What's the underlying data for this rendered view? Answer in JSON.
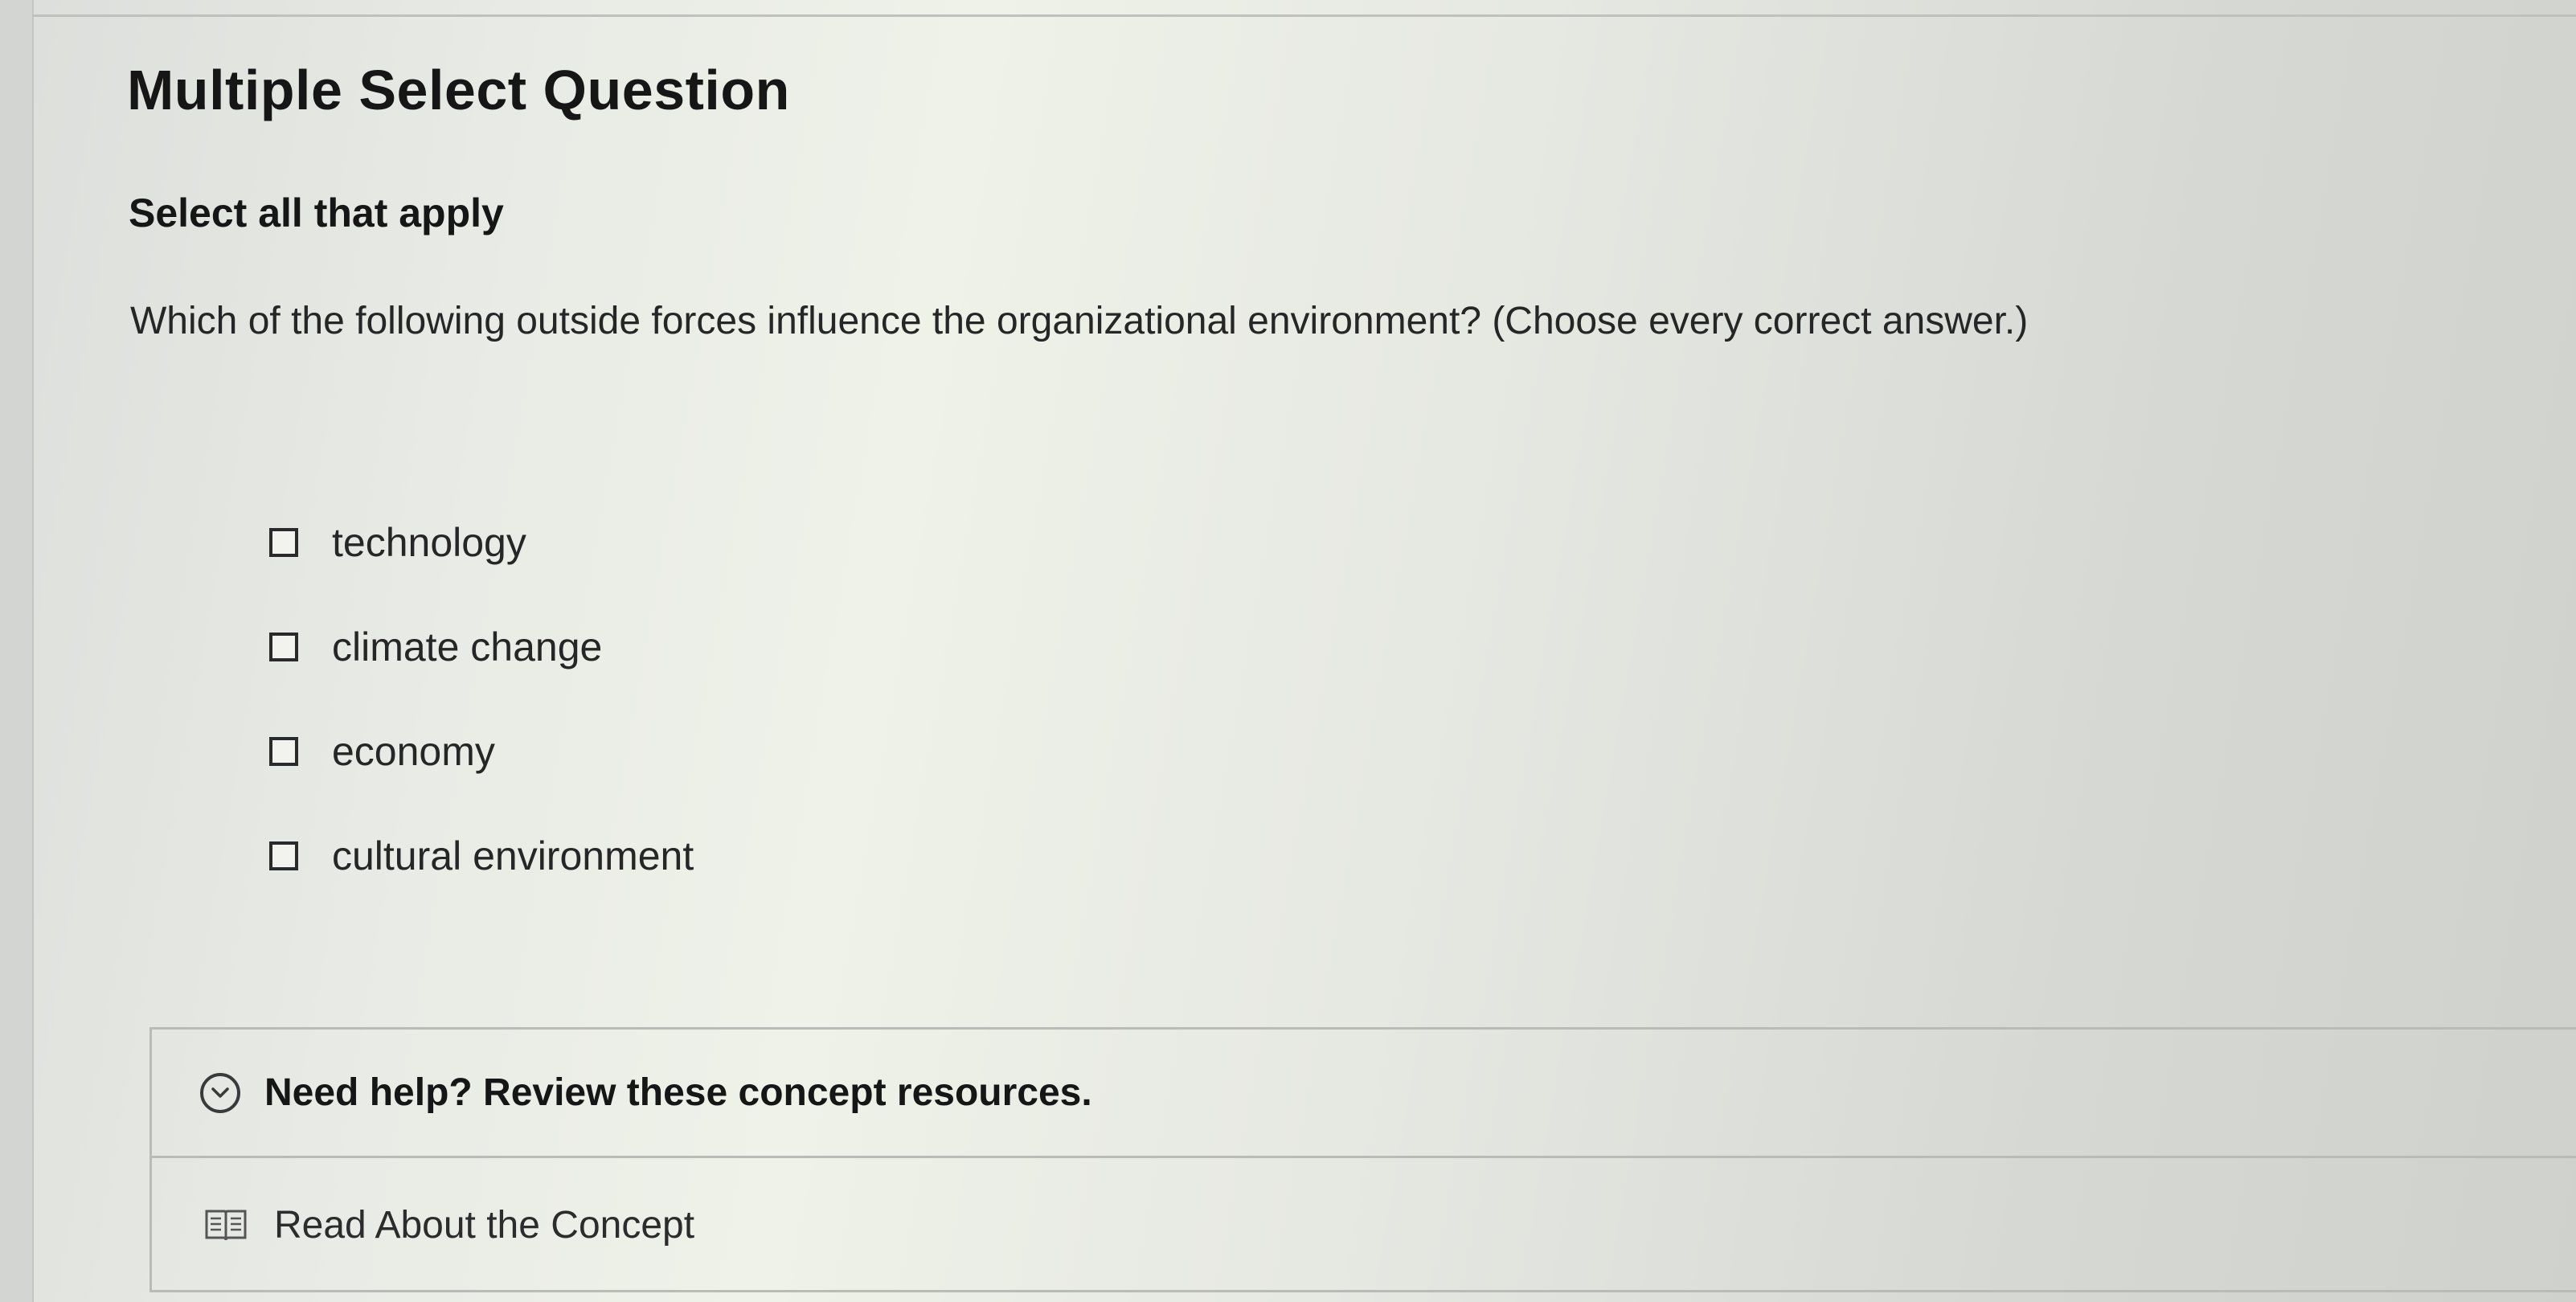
{
  "question": {
    "type_label": "Multiple Select Question",
    "instruction": "Select all that apply",
    "prompt": "Which of the following outside forces influence the organizational environment? (Choose every correct answer.)"
  },
  "options": [
    {
      "label": "technology",
      "checked": false
    },
    {
      "label": "climate change",
      "checked": false
    },
    {
      "label": "economy",
      "checked": false
    },
    {
      "label": "cultural environment",
      "checked": false
    }
  ],
  "help": {
    "toggle_label": "Need help? Review these concept resources.",
    "toggle_icon": "chevron-down-circle-icon",
    "resource_label": "Read About the Concept",
    "resource_icon": "book-icon"
  }
}
